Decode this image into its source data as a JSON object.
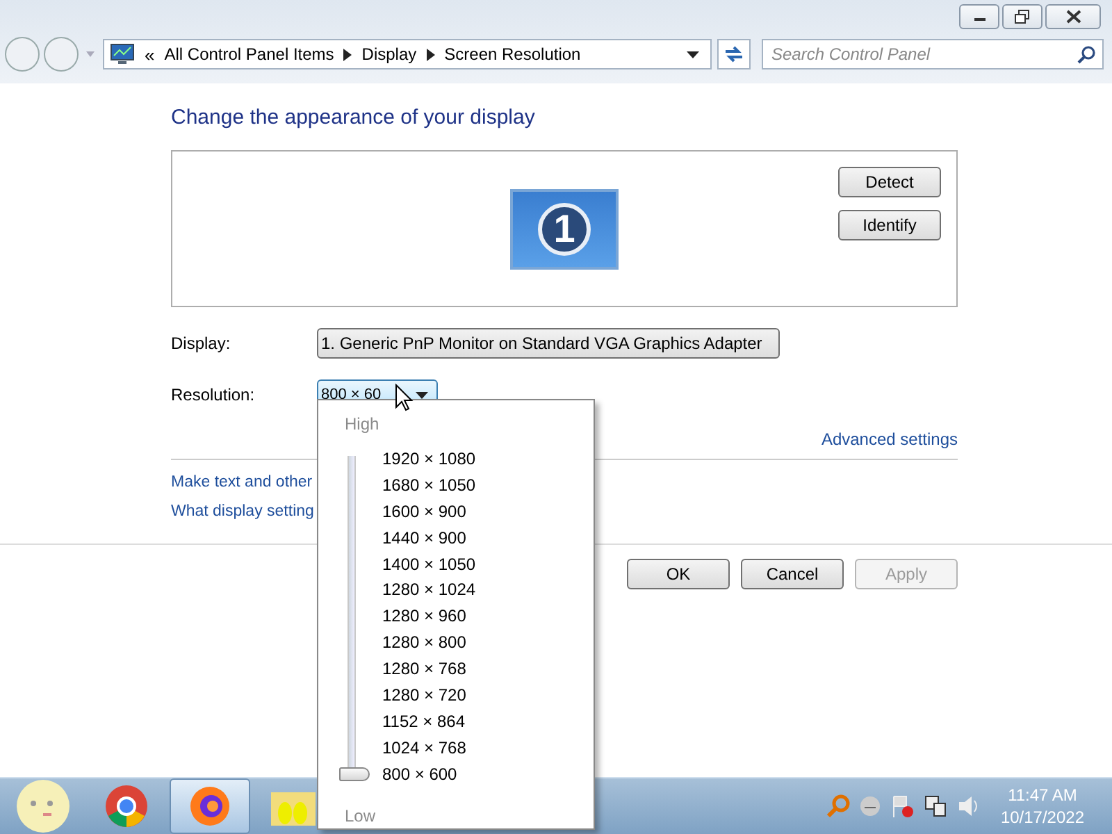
{
  "address_bar": {
    "prefix": "«",
    "crumbs": [
      "All Control Panel Items",
      "Display",
      "Screen Resolution"
    ]
  },
  "search": {
    "placeholder": "Search Control Panel"
  },
  "heading": "Change the appearance of your display",
  "monitor_preview": {
    "number": "1"
  },
  "preview_buttons": [
    "Detect",
    "Identify"
  ],
  "display": {
    "label": "Display:",
    "value": "1. Generic PnP Monitor on Standard VGA Graphics Adapter"
  },
  "resolution": {
    "label": "Resolution:",
    "value": "800 × 60",
    "expanded": true
  },
  "advanced_link": "Advanced settings",
  "links": [
    "Make text and other",
    "What display setting"
  ],
  "buttons": [
    {
      "label": "OK",
      "disabled": false
    },
    {
      "label": "Cancel",
      "disabled": false
    },
    {
      "label": "Apply",
      "disabled": true
    }
  ],
  "resolution_menu": {
    "high_label": "High",
    "low_label": "Low",
    "slider": {
      "level": 0
    },
    "options": [
      "1920 × 1080",
      "1680 × 1050",
      "1600 × 900",
      "1440 × 900",
      "1400 × 1050",
      "1280 × 1024",
      "1280 × 960",
      "1280 × 800",
      "1280 × 768",
      "1280 × 720",
      "1152 × 864",
      "1024 × 768",
      "800 × 600"
    ]
  },
  "taskbar": {
    "apps": [
      {
        "kind": "start",
        "active": false
      },
      {
        "kind": "chrome",
        "active": false
      },
      {
        "kind": "firefox",
        "active": true
      },
      {
        "kind": "folder",
        "active": false
      }
    ],
    "clock": {
      "time": "11:47 AM",
      "date": "10/17/2022"
    }
  }
}
